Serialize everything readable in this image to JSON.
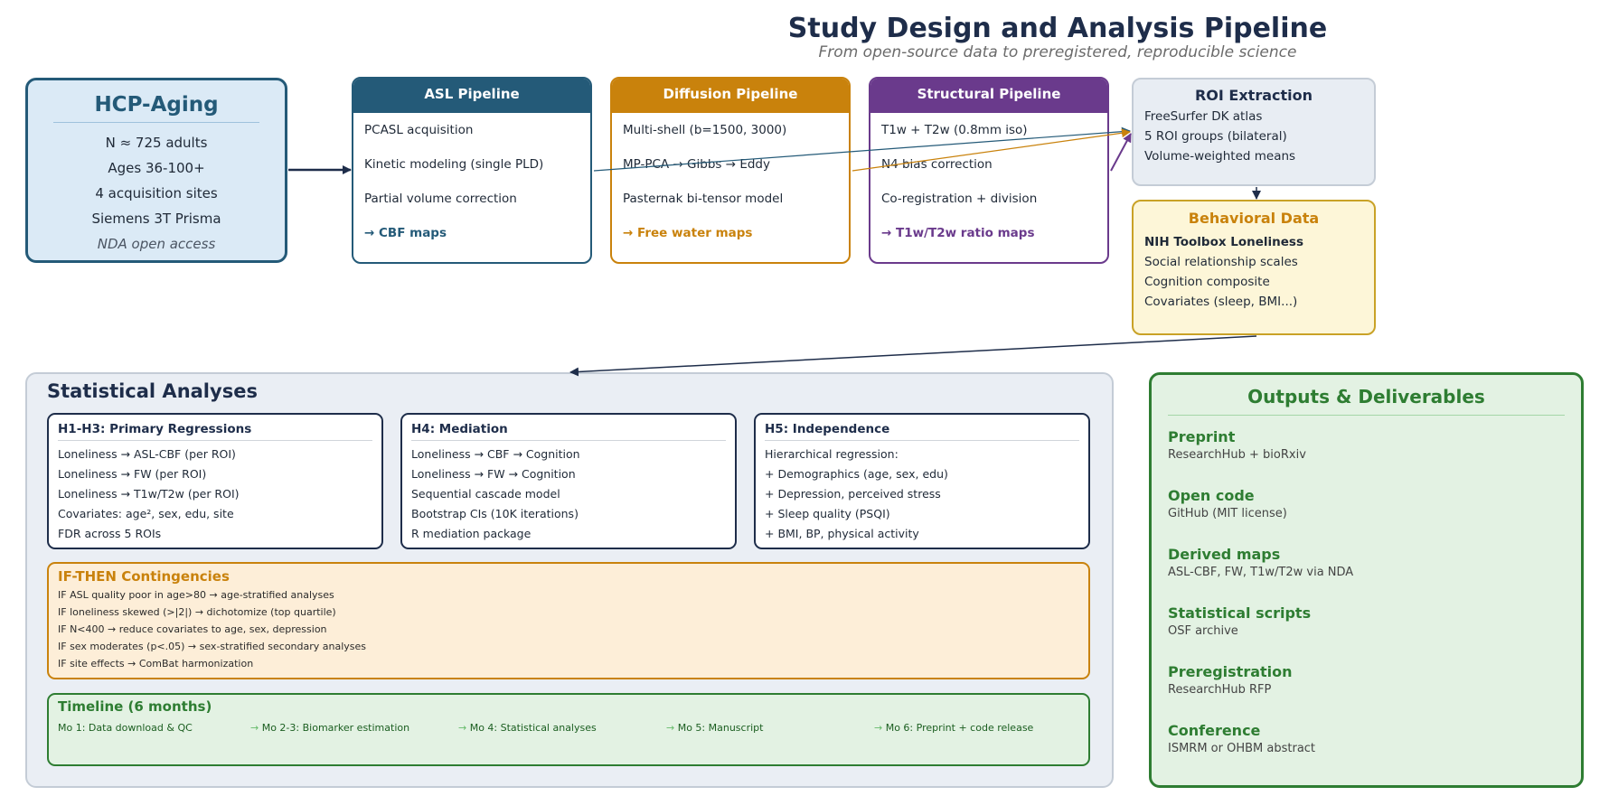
{
  "header": {
    "title": "Study Design and Analysis Pipeline",
    "subtitle": "From open-source data to preregistered, reproducible science"
  },
  "hcp": {
    "title": "HCP-Aging",
    "lines": [
      "N ≈ 725 adults",
      "Ages 36-100+",
      "4 acquisition sites",
      "Siemens 3T Prisma",
      "NDA open access"
    ]
  },
  "pipelines": {
    "asl": {
      "title": "ASL Pipeline",
      "steps": [
        "PCASL acquisition",
        "Kinetic modeling (single PLD)",
        "Partial volume correction"
      ],
      "output": "→ CBF maps"
    },
    "diffusion": {
      "title": "Diffusion Pipeline",
      "steps": [
        "Multi-shell (b=1500, 3000)",
        "MP-PCA → Gibbs → Eddy",
        "Pasternak bi-tensor model"
      ],
      "output": "→ Free water maps"
    },
    "structural": {
      "title": "Structural Pipeline",
      "steps": [
        "T1w + T2w (0.8mm iso)",
        "N4 bias correction",
        "Co-registration + division"
      ],
      "output": "→ T1w/T2w ratio maps"
    }
  },
  "roi": {
    "title": "ROI Extraction",
    "lines": [
      "FreeSurfer DK atlas",
      "5 ROI groups (bilateral)",
      "Volume-weighted means"
    ]
  },
  "behavioral": {
    "title": "Behavioral Data",
    "lines": [
      "NIH Toolbox Loneliness",
      "Social relationship scales",
      "Cognition composite",
      "Covariates (sleep, BMI...)"
    ]
  },
  "stats": {
    "title": "Statistical Analyses",
    "h13": {
      "title": "H1-H3: Primary Regressions",
      "lines": [
        "Loneliness → ASL-CBF (per ROI)",
        "Loneliness → FW (per ROI)",
        "Loneliness → T1w/T2w (per ROI)",
        "Covariates: age², sex, edu, site",
        "FDR across 5 ROIs"
      ]
    },
    "h4": {
      "title": "H4: Mediation",
      "lines": [
        "Loneliness → CBF → Cognition",
        "Loneliness → FW → Cognition",
        "Sequential cascade model",
        "Bootstrap CIs (10K iterations)",
        "R mediation package"
      ]
    },
    "h5": {
      "title": "H5: Independence",
      "lines": [
        "Hierarchical regression:",
        "+ Demographics (age, sex, edu)",
        "+ Depression, perceived stress",
        "+ Sleep quality (PSQI)",
        "+ BMI, BP, physical activity"
      ]
    },
    "contingencies": {
      "title": "IF-THEN Contingencies",
      "lines": [
        "IF ASL quality poor in age>80 → age-stratified analyses",
        "IF loneliness skewed (>|2|) → dichotomize (top quartile)",
        "IF N<400 → reduce covariates to age, sex, depression",
        "IF sex moderates (p<.05) → sex-stratified secondary analyses",
        "IF site effects → ComBat harmonization"
      ]
    },
    "timeline": {
      "title": "Timeline (6 months)",
      "arrow": "→",
      "items": [
        "Mo 1: Data download & QC",
        "Mo 2-3: Biomarker estimation",
        "Mo 4: Statistical analyses",
        "Mo 5: Manuscript",
        "Mo 6: Preprint + code release"
      ]
    }
  },
  "outputs": {
    "title": "Outputs & Deliverables",
    "items": [
      {
        "name": "Preprint",
        "desc": "ResearchHub + bioRxiv"
      },
      {
        "name": "Open code",
        "desc": "GitHub (MIT license)"
      },
      {
        "name": "Derived maps",
        "desc": "ASL-CBF, FW, T1w/T2w via NDA"
      },
      {
        "name": "Statistical scripts",
        "desc": "OSF archive"
      },
      {
        "name": "Preregistration",
        "desc": "ResearchHub RFP"
      },
      {
        "name": "Conference",
        "desc": "ISMRM or OHBM abstract"
      }
    ]
  },
  "colors": {
    "navy": "#1e2d4a",
    "asl": "#245a78",
    "diffusion": "#c9820c",
    "structural": "#6a3a8c",
    "green": "#2e7d32"
  }
}
